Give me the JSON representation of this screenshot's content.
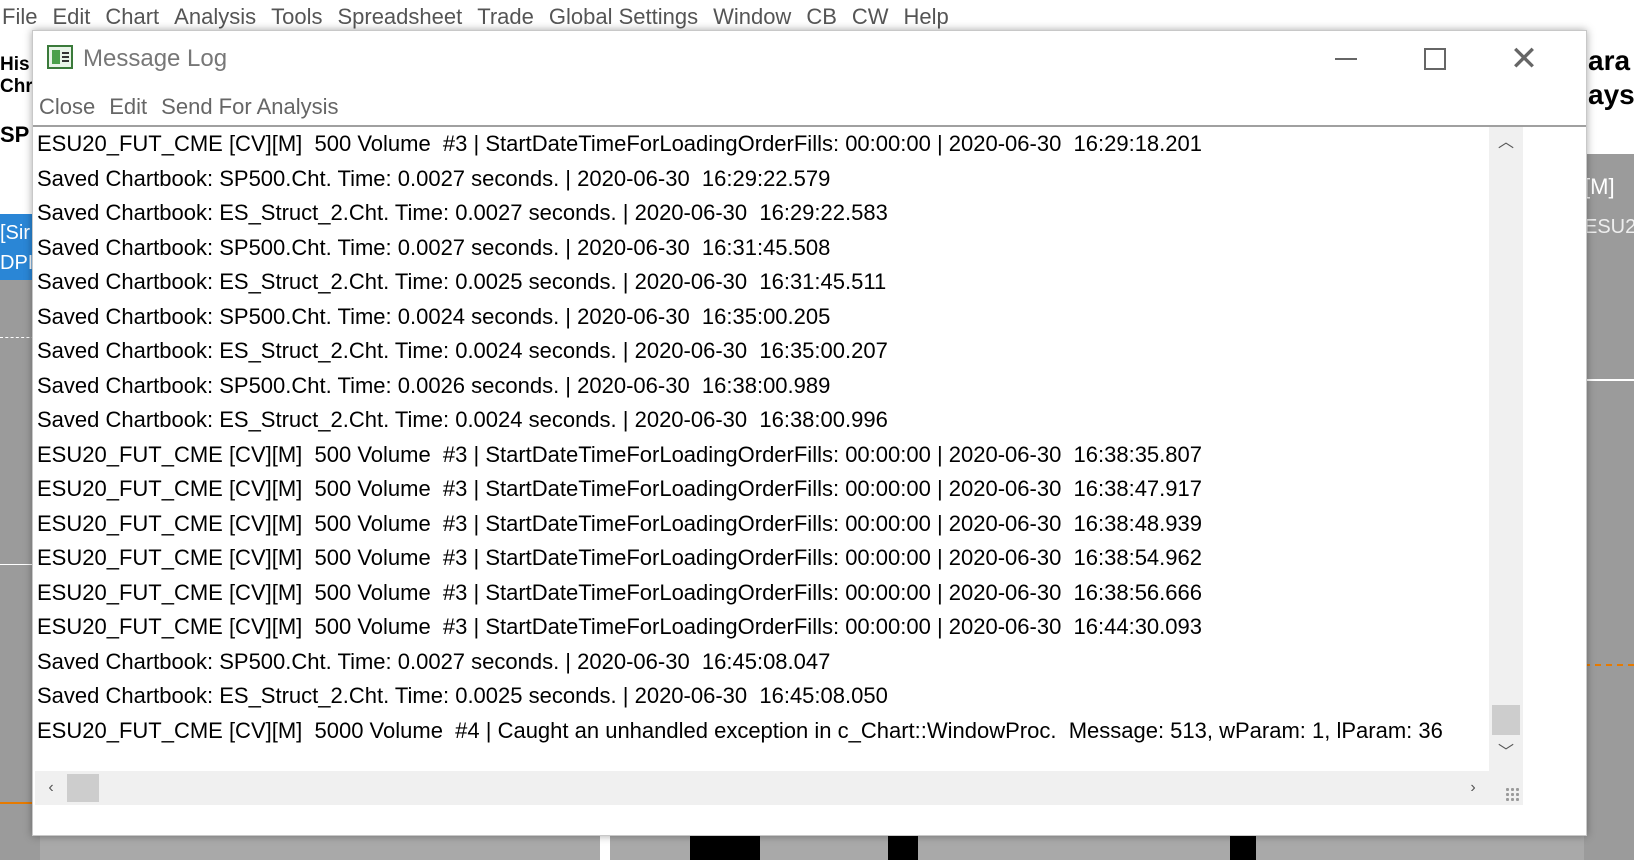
{
  "app_menu": [
    "File",
    "Edit",
    "Chart",
    "Analysis",
    "Tools",
    "Spreadsheet",
    "Trade",
    "Global Settings",
    "Window",
    "CB",
    "CW",
    "Help"
  ],
  "background": {
    "left_top_lines": [
      "His",
      "Chr"
    ],
    "left_sp": "SP",
    "left_blue_lines": [
      "[Sir",
      "DPI"
    ],
    "right_top_lines": [
      "ara",
      "ays"
    ],
    "right_mid": "[M]",
    "right_mid2": "ESU2"
  },
  "window": {
    "title": "Message Log",
    "menu": [
      "Close",
      "Edit",
      "Send For Analysis"
    ]
  },
  "log_lines": [
    "ESU20_FUT_CME [CV][M]  500 Volume  #3 | StartDateTimeForLoadingOrderFills: 00:00:00 | 2020-06-30  16:29:18.201",
    "Saved Chartbook: SP500.Cht. Time: 0.0027 seconds. | 2020-06-30  16:29:22.579",
    "Saved Chartbook: ES_Struct_2.Cht. Time: 0.0027 seconds. | 2020-06-30  16:29:22.583",
    "Saved Chartbook: SP500.Cht. Time: 0.0027 seconds. | 2020-06-30  16:31:45.508",
    "Saved Chartbook: ES_Struct_2.Cht. Time: 0.0025 seconds. | 2020-06-30  16:31:45.511",
    "Saved Chartbook: SP500.Cht. Time: 0.0024 seconds. | 2020-06-30  16:35:00.205",
    "Saved Chartbook: ES_Struct_2.Cht. Time: 0.0024 seconds. | 2020-06-30  16:35:00.207",
    "Saved Chartbook: SP500.Cht. Time: 0.0026 seconds. | 2020-06-30  16:38:00.989",
    "Saved Chartbook: ES_Struct_2.Cht. Time: 0.0024 seconds. | 2020-06-30  16:38:00.996",
    "ESU20_FUT_CME [CV][M]  500 Volume  #3 | StartDateTimeForLoadingOrderFills: 00:00:00 | 2020-06-30  16:38:35.807",
    "ESU20_FUT_CME [CV][M]  500 Volume  #3 | StartDateTimeForLoadingOrderFills: 00:00:00 | 2020-06-30  16:38:47.917",
    "ESU20_FUT_CME [CV][M]  500 Volume  #3 | StartDateTimeForLoadingOrderFills: 00:00:00 | 2020-06-30  16:38:48.939",
    "ESU20_FUT_CME [CV][M]  500 Volume  #3 | StartDateTimeForLoadingOrderFills: 00:00:00 | 2020-06-30  16:38:54.962",
    "ESU20_FUT_CME [CV][M]  500 Volume  #3 | StartDateTimeForLoadingOrderFills: 00:00:00 | 2020-06-30  16:38:56.666",
    "ESU20_FUT_CME [CV][M]  500 Volume  #3 | StartDateTimeForLoadingOrderFills: 00:00:00 | 2020-06-30  16:44:30.093",
    "Saved Chartbook: SP500.Cht. Time: 0.0027 seconds. | 2020-06-30  16:45:08.047",
    "Saved Chartbook: ES_Struct_2.Cht. Time: 0.0025 seconds. | 2020-06-30  16:45:08.050",
    "ESU20_FUT_CME [CV][M]  5000 Volume  #4 | Caught an unhandled exception in c_Chart::WindowProc.  Message: 513, wParam: 1, lParam: 36"
  ],
  "icons": {
    "app": "message-log-app-icon",
    "minimize": "minimize-icon",
    "maximize": "maximize-icon",
    "close": "close-icon",
    "scroll_up": "chevron-up-icon",
    "scroll_down": "chevron-down-icon",
    "scroll_left": "chevron-left-icon",
    "scroll_right": "chevron-right-icon"
  },
  "glyphs": {
    "close": "✕",
    "up": "︿",
    "down": "﹀",
    "left": "‹",
    "right": "›"
  }
}
